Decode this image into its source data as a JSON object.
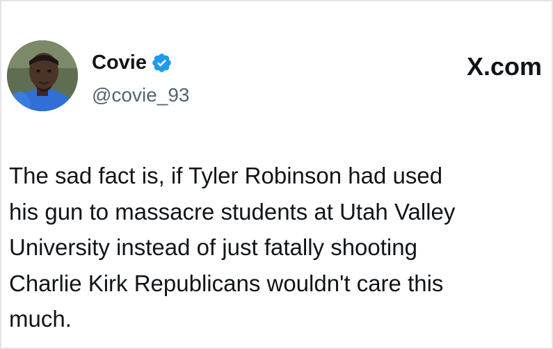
{
  "tweet": {
    "author": {
      "display_name": "Covie",
      "handle": "@covie_93",
      "verified": true,
      "verified_icon": "verified-badge-icon",
      "verified_color": "#1d9bf0",
      "avatar": "avatar-photo"
    },
    "brand": {
      "label": "X.com"
    },
    "text": "The sad fact is, if Tyler Robinson had used\nhis gun to massacre students at Utah Valley\nUniversity instead of just fatally shooting\nCharlie Kirk Republicans wouldn't care this\nmuch."
  },
  "colors": {
    "background": "#ffffff",
    "text": "#0f1419",
    "secondary_text": "#536471",
    "accent": "#1d9bf0"
  }
}
